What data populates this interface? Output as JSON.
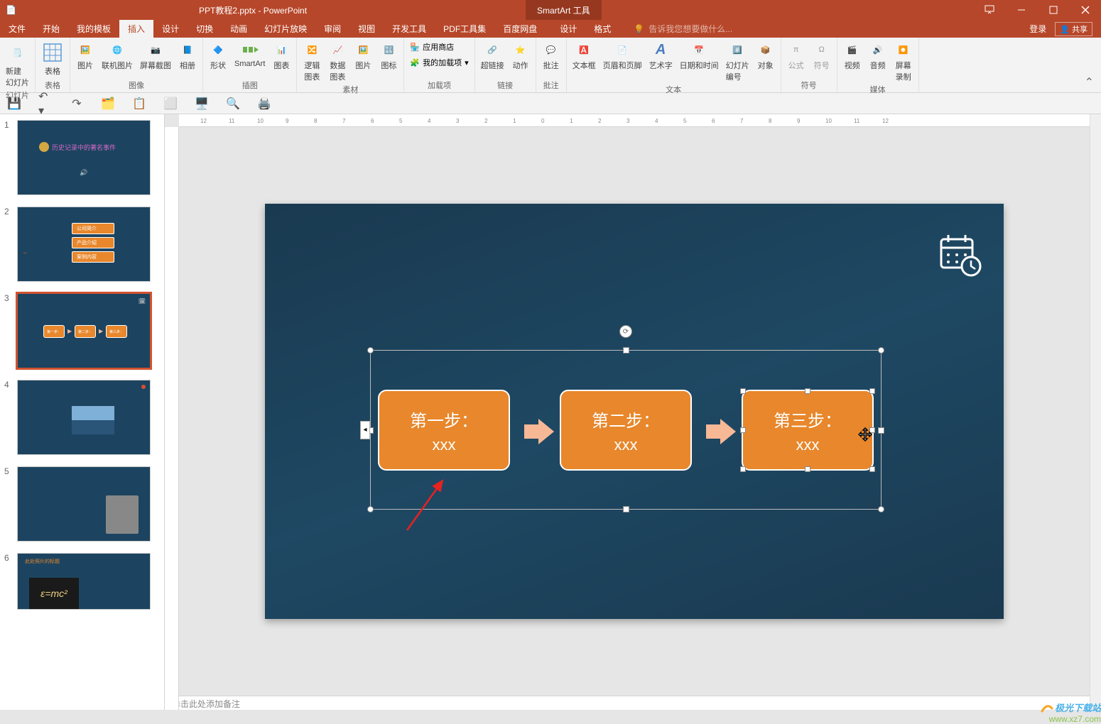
{
  "title": "PPT教程2.pptx - PowerPoint",
  "smartart_tool": "SmartArt 工具",
  "login": "登录",
  "share": "共享",
  "tell_me_placeholder": "告诉我您想要做什么...",
  "tabs": {
    "file": "文件",
    "home": "开始",
    "my_template": "我的模板",
    "insert": "插入",
    "design": "设计",
    "transition": "切换",
    "animation": "动画",
    "slideshow": "幻灯片放映",
    "review": "审阅",
    "view": "视图",
    "developer": "开发工具",
    "pdf": "PDF工具集",
    "baidu": "百度网盘",
    "sa_design": "设计",
    "sa_format": "格式"
  },
  "ribbon": {
    "new_slide": "新建\n幻灯片",
    "slides": "幻灯片",
    "table": "表格",
    "tables": "表格",
    "picture": "图片",
    "online_pic": "联机图片",
    "screenshot": "屏幕截图",
    "album": "相册",
    "images": "图像",
    "shapes": "形状",
    "smartart": "SmartArt",
    "chart": "图表",
    "illustrations": "插图",
    "logic_chart": "逻辑\n图表",
    "data_chart": "数据\n图表",
    "pic2": "图片",
    "icon": "图标",
    "materials": "素材",
    "store": "应用商店",
    "my_addins": "我的加载项",
    "addins": "加载项",
    "hyperlink": "超链接",
    "action": "动作",
    "links": "链接",
    "comment": "批注",
    "comments": "批注",
    "textbox": "文本框",
    "header_footer": "页眉和页脚",
    "wordart": "艺术字",
    "datetime": "日期和时间",
    "slide_num": "幻灯片\n编号",
    "object": "对象",
    "text": "文本",
    "equation": "公式",
    "symbol": "符号",
    "symbols": "符号",
    "video": "视频",
    "audio": "音频",
    "screen_rec": "屏幕\n录制",
    "media": "媒体"
  },
  "slide_content": {
    "step1_title": "第一步：",
    "step1_sub": "xxx",
    "step2_title": "第二步：",
    "step2_sub": "xxx",
    "step3_title": "第三步：",
    "step3_sub": "xxx"
  },
  "thumbs": {
    "t1_title": "历史记录中的著名事件",
    "t2_a": "公司简介",
    "t2_b": "产品介绍",
    "t2_c": "案例内容",
    "t3_a": "第一步：",
    "t3_b": "第二步：",
    "t3_c": "第三步：",
    "t6_title": "此处照片的标题",
    "t6_formula": "ε=mc²"
  },
  "notes_placeholder": "单击此处添加备注",
  "watermark": {
    "line1": "极光下载站",
    "line2": "www.xz7.com"
  },
  "slide_numbers": [
    "1",
    "2",
    "3",
    "4",
    "5",
    "6"
  ]
}
